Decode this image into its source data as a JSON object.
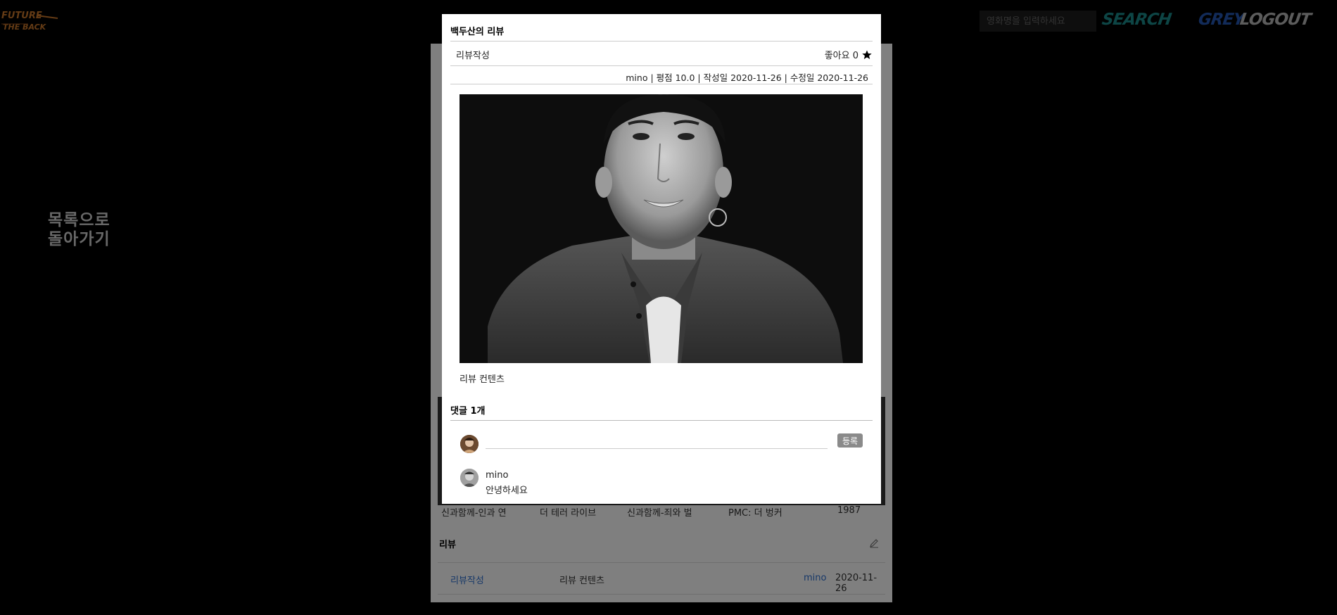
{
  "header": {
    "logo_text": "FUTURE THE BACK",
    "search_placeholder": "영화명을 입력하세요",
    "search_label": "SEARCH",
    "user_label": "GREY",
    "logout_label": "LOGOUT"
  },
  "sidebar": {
    "back_line1": "목록으로",
    "back_line2": "돌아가기"
  },
  "page": {
    "related_movies": [
      "신과함께-인과 연",
      "더 테러 라이브",
      "신과함께-죄와 벌",
      "PMC: 더 벙커",
      "1987"
    ],
    "review_section_title": "리뷰",
    "review_row": {
      "title": "리뷰작성",
      "content": "리뷰 컨텐츠",
      "author": "mino",
      "date": "2020-11-26"
    }
  },
  "modal": {
    "title": "백두산의 리뷰",
    "review_title": "리뷰작성",
    "like_label": "좋아요 0",
    "meta": "mino | 평점 10.0 | 작성일 2020-11-26 | 수정일 2020-11-26",
    "content": "리뷰 컨텐츠",
    "comments_title": "댓글 1개",
    "comment_input_placeholder": "",
    "comment_submit": "등록",
    "comments": [
      {
        "author": "mino",
        "text": "안녕하세요"
      }
    ]
  },
  "colors": {
    "search_accent": "#1a8a8a",
    "user_accent": "#2456b3",
    "link_blue": "#2c6fd1"
  }
}
